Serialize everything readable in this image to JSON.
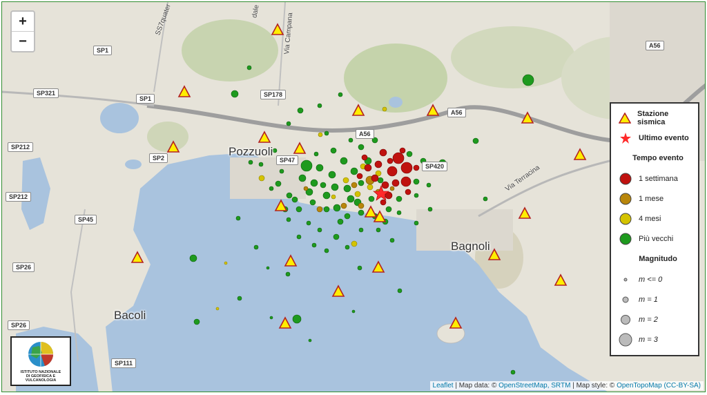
{
  "zoom": {
    "in_label": "+",
    "out_label": "−"
  },
  "places": {
    "pozzuoli": "Pozzuoli",
    "bagnoli": "Bagnoli",
    "bacoli": "Bacoli"
  },
  "roads": {
    "sp1_a": "SP1",
    "sp1_b": "SP1",
    "sp321": "SP321",
    "sp178": "SP178",
    "a56_a": "A56",
    "a56_b": "A56",
    "a56_c": "A56",
    "sp212_a": "SP212",
    "sp212_b": "SP212",
    "sp2": "SP2",
    "sp47": "SP47",
    "sp420": "SP420",
    "sp45": "SP45",
    "sp26_a": "SP26",
    "sp26_b": "SP26",
    "sp111": "SP111",
    "via_terracina": "Via Terracina",
    "via_campana": "Via Campana",
    "ss7_quater": "SS7quater",
    "dale": "dale"
  },
  "legend": {
    "station": "Stazione sismica",
    "last_event": "Ultimo evento",
    "time_title": "Tempo evento",
    "t1": "1 settimana",
    "t2": "1 mese",
    "t3": "4 mesi",
    "t4": "Più vecchi",
    "mag_title": "Magnitudo",
    "m0": "m <= 0",
    "m1": "m = 1",
    "m2": "m = 2",
    "m3": "m = 3"
  },
  "colors": {
    "week": "#c0120f",
    "month": "#b8860b",
    "four_months": "#d4c300",
    "older": "#1e9a1e",
    "station": "#ffee00",
    "station_border": "#b22222",
    "sea": "#a9c3de"
  },
  "logo": {
    "line1": "ISTITUTO NAZIONALE",
    "line2": "DI GEOFISICA E VULCANOLOGIA"
  },
  "attribution": {
    "leaflet": "Leaflet",
    "text1": " | Map data: © ",
    "osm": "OpenStreetMap, SRTM",
    "text2": " | Map style: © ",
    "otm": "OpenTopoMap",
    "license": "(CC-BY-SA)"
  }
}
